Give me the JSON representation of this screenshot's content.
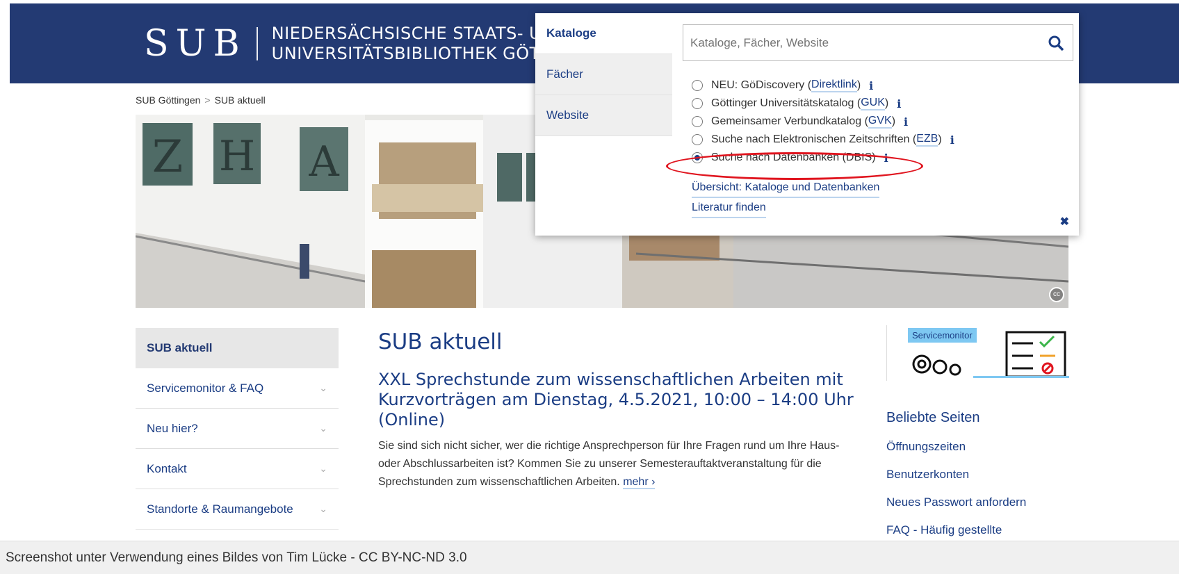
{
  "header": {
    "logo_mark": "SUB",
    "logo_line1": "NIEDERSÄCHSISCHE STAATS- UND",
    "logo_line2": "UNIVERSITÄTSBIBLIOTHEK GÖTTI"
  },
  "breadcrumb": {
    "items": [
      "SUB Göttingen",
      "SUB aktuell"
    ],
    "separator": ">"
  },
  "hero": {
    "license_badge": "cc"
  },
  "leftnav": {
    "items": [
      {
        "label": "SUB aktuell",
        "active": true
      },
      {
        "label": "Servicemonitor & FAQ",
        "chevron": "chevron-down-icon"
      },
      {
        "label": "Neu hier?",
        "chevron": "chevron-down-icon"
      },
      {
        "label": "Kontakt",
        "chevron": "chevron-down-icon"
      },
      {
        "label": "Standorte & Raumangebote",
        "chevron": "chevron-down-icon"
      }
    ],
    "chevron_glyph": "⌄"
  },
  "main": {
    "title": "SUB aktuell",
    "article_title": "XXL Sprechstunde zum wissenschaftlichen Arbeiten mit Kurzvorträgen am Dienstag, 4.5.2021, 10:00 – 14:00 Uhr (Online)",
    "article_text": "Sie sind sich nicht sicher, wer die richtige Ansprechperson für Ihre Fragen rund um Ihre Haus- oder Abschlussarbeiten ist? Kommen Sie zu unserer Semesterauftaktveranstaltung für die Sprechstunden zum wissenschaftlichen Arbeiten.",
    "more_link": "mehr ›"
  },
  "sidebar": {
    "servicemonitor_label": "Servicemonitor",
    "popular_title": "Beliebte Seiten",
    "popular_links": [
      "Öffnungszeiten",
      "Benutzerkonten",
      "Neues Passwort anfordern",
      "FAQ - Häufig gestellte"
    ]
  },
  "search_panel": {
    "tabs": [
      {
        "label": "Kataloge",
        "active": true
      },
      {
        "label": "Fächer"
      },
      {
        "label": "Website"
      }
    ],
    "placeholder": "Kataloge, Fächer, Website",
    "options": [
      {
        "text": "NEU: GöDiscovery (",
        "link": "Direktlink",
        "suffix": ")",
        "checked": false
      },
      {
        "text": "Göttinger Universitätskatalog (",
        "link": "GUK",
        "suffix": ")",
        "checked": false
      },
      {
        "text": "Gemeinsamer Verbundkatalog (",
        "link": "GVK",
        "suffix": ")",
        "checked": false
      },
      {
        "text": "Suche nach Elektronischen Zeitschriften (",
        "link": "EZB",
        "suffix": ")",
        "checked": false
      },
      {
        "text": "Suche nach Datenbanken (DBIS)",
        "link": "",
        "suffix": "",
        "checked": true
      }
    ],
    "info_glyph": "i",
    "links": [
      "Übersicht: Kataloge und Datenbanken",
      "Literatur finden"
    ],
    "close_glyph": "✖",
    "highlight_color": "#e0151f"
  },
  "footer": {
    "credit": "Screenshot unter Verwendung eines Bildes von Tim Lücke - CC BY-NC-ND 3.0"
  },
  "colors": {
    "header_bg": "#233a73",
    "link": "#1b3d84",
    "servicemonitor_blue": "#7ec8f2"
  }
}
